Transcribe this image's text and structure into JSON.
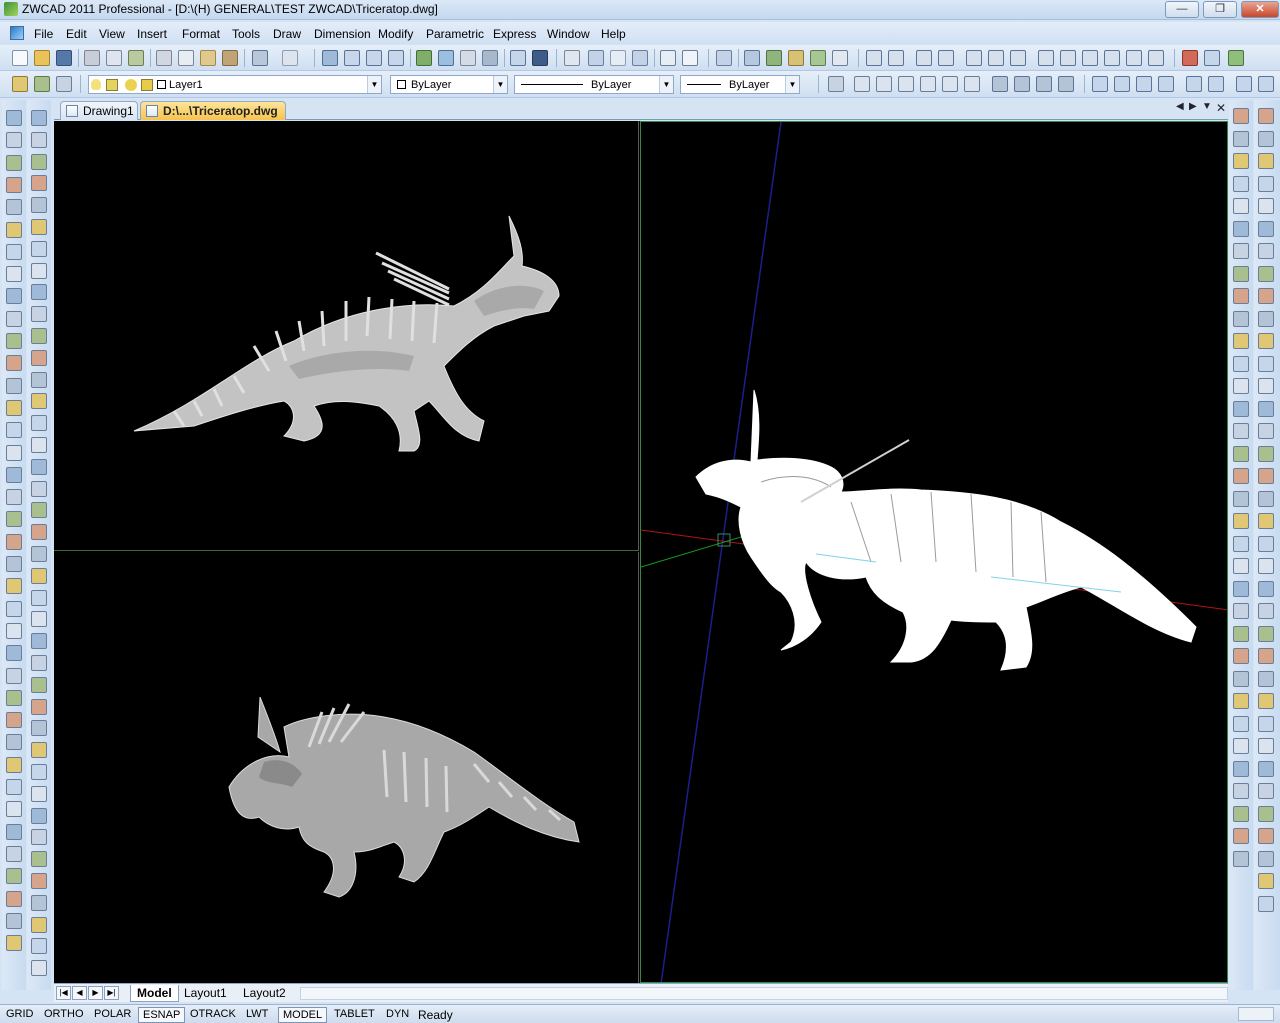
{
  "window": {
    "title": "ZWCAD 2011 Professional - [D:\\(H)  GENERAL\\TEST ZWCAD\\Triceratop.dwg]",
    "min_label": "—",
    "max_label": "❐",
    "close_label": "✕"
  },
  "menu": {
    "items": [
      "File",
      "Edit",
      "View",
      "Insert",
      "Format",
      "Tools",
      "Draw",
      "Dimension",
      "Modify",
      "Parametric",
      "Express",
      "Window",
      "Help"
    ]
  },
  "layers": {
    "current_layer": "Layer1",
    "color": "ByLayer",
    "linetype": "ByLayer",
    "lineweight": "ByLayer"
  },
  "doc_tabs": [
    "Drawing1",
    "D:\\...\\Triceratop.dwg"
  ],
  "layout_tabs": [
    "Model",
    "Layout1",
    "Layout2"
  ],
  "status": {
    "toggles": [
      "GRID",
      "ORTHO",
      "POLAR",
      "ESNAP",
      "OTRACK",
      "LWT",
      "MODEL",
      "TABLET",
      "DYN"
    ],
    "ready": "Ready"
  },
  "colors": {
    "canvas": "#000000",
    "model_light": "#ffffff",
    "model_gray": "#bdbdbd",
    "axis_x": "#b01515",
    "axis_y": "#1b9a1b",
    "axis_z": "#1b1f8a",
    "viewport_border": "#2e8a45"
  }
}
